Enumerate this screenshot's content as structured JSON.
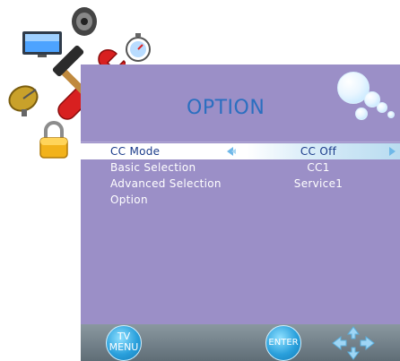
{
  "panel": {
    "title": "OPTION"
  },
  "menu": {
    "rows": [
      {
        "label": "CC Mode",
        "value": "CC Off",
        "selected": true
      },
      {
        "label": "Basic Selection",
        "value": "CC1",
        "selected": false
      },
      {
        "label": "Advanced Selection",
        "value": "Service1",
        "selected": false
      },
      {
        "label": "Option",
        "value": "",
        "selected": false
      }
    ]
  },
  "footer": {
    "menu_button": {
      "line1": "TV",
      "line2": "MENU"
    },
    "enter_button": {
      "label": "ENTER"
    }
  },
  "icons": [
    "monitor-icon",
    "speaker-icon",
    "stopwatch-icon",
    "tools-icon",
    "satellite-dish-icon",
    "padlock-icon",
    "bubbles-icon",
    "left-arrow-icon",
    "right-arrow-icon",
    "navigation-arrows-icon"
  ],
  "colors": {
    "panel": "#9b8fc7",
    "title": "#2b6fc0",
    "button": "#2aa0dc"
  }
}
